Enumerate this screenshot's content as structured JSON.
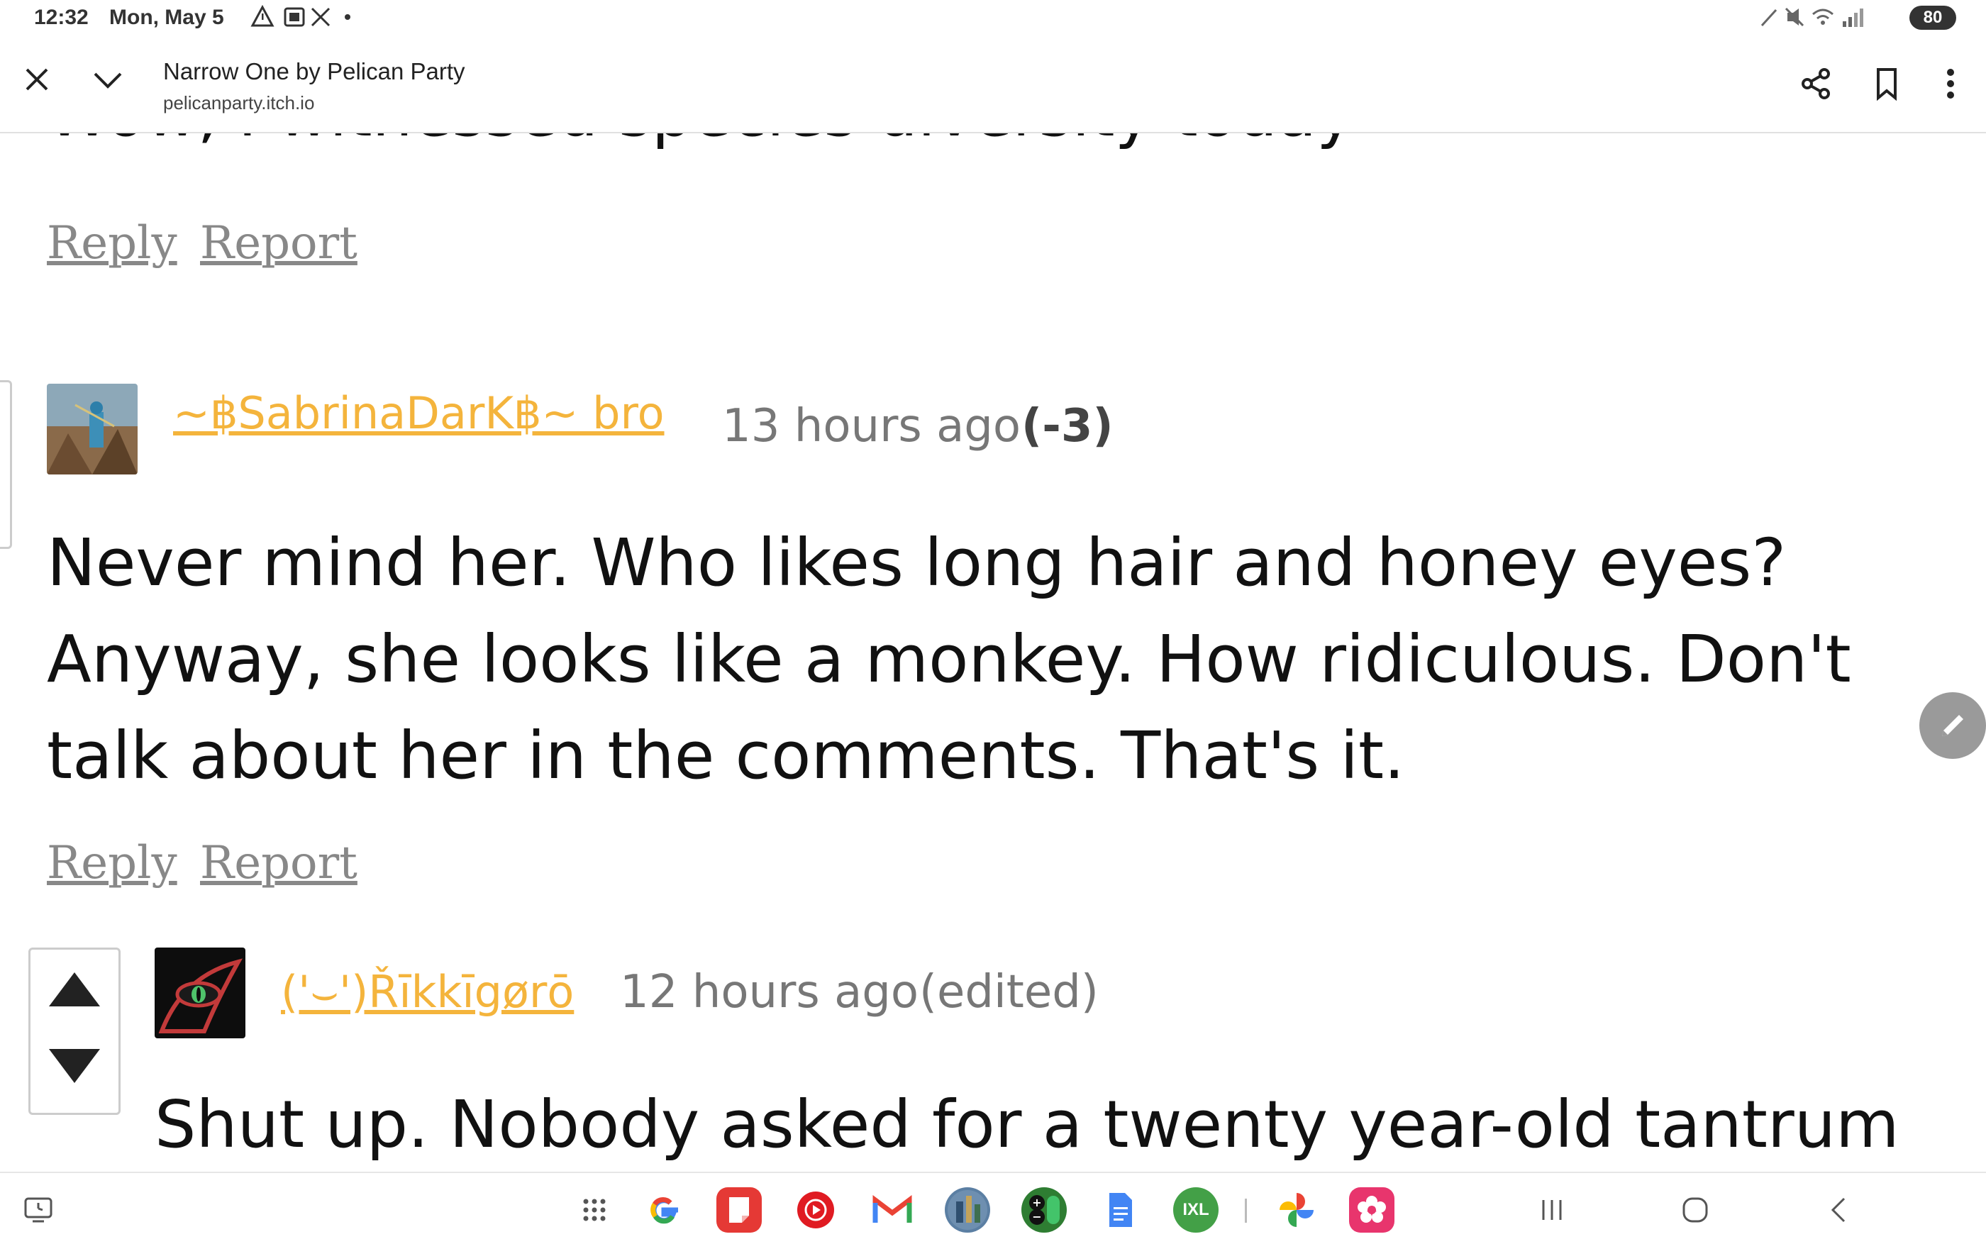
{
  "status_bar": {
    "time": "12:32",
    "date": "Mon, May 5",
    "left_icons": "⚠ ▣ ✕ •",
    "right_icons": "✎ 🔇 ◥ .▎▎",
    "battery": "80"
  },
  "toolbar": {
    "title": "Narrow One by Pelican Party",
    "url": "pelicanparty.itch.io",
    "close_icon": "close-icon",
    "minimize_icon": "chevron-down-icon",
    "share_icon": "share-icon",
    "bookmark_icon": "bookmark-icon",
    "menu_icon": "more-vert-icon"
  },
  "comments": {
    "previous_cut_text": "Wow, I witnessed species diversity today",
    "previous_actions": {
      "reply": "Reply",
      "report": "Report"
    },
    "comment1": {
      "username": "꧂฿SabrinaDarK฿꧂ bro",
      "username_display": "~฿SabrinaDarK฿~ bro",
      "time": "13 hours ago",
      "score": "(-3)",
      "body": "Never mind her. Who likes long hair and honey eyes? Anyway, she looks like a monkey. How ridiculous. Don't talk about her in the comments. That's it.",
      "reply": "Reply",
      "report": "Report"
    },
    "comment2": {
      "username": "('⌣')Řīkkīgørō",
      "time": "12 hours ago",
      "edited": "(edited)",
      "body": "Shut up. Nobody asked for a twenty year-old tantrum"
    }
  },
  "colors": {
    "username": "#f4b43c",
    "link": "#888888",
    "fab": "#9a9a9a"
  },
  "dock": {
    "apps": [
      "google",
      "notes",
      "youtube-music",
      "gmail",
      "game",
      "calculator",
      "docs",
      "ixl",
      "photos",
      "gallery"
    ],
    "ixl_label": "IXL"
  }
}
